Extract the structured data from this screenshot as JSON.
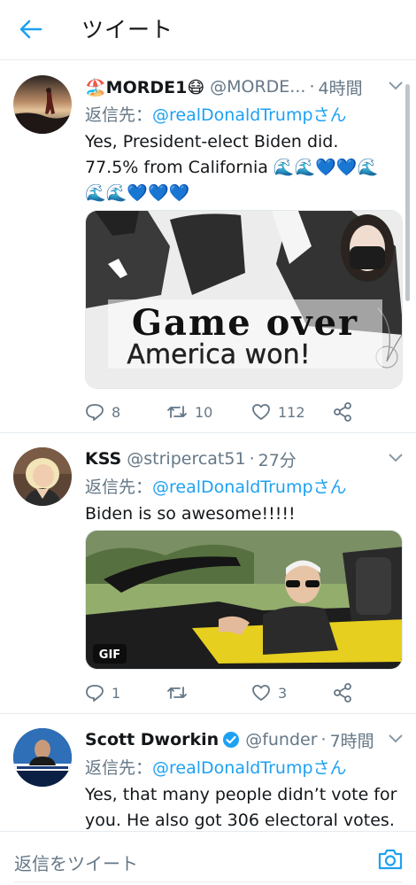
{
  "header": {
    "title": "ツイート"
  },
  "tweets": [
    {
      "name": "🏖️MORDE1😷",
      "handle": "@MORDE...",
      "time": "4時間",
      "reply_prefix": "返信先：",
      "reply_mention": "@realDonaldTrumpさん",
      "text_line1": "Yes, President-elect Biden did.",
      "text_line2": "77.5% from California 🌊🌊💙💙🌊",
      "text_line3": "🌊🌊💙💙💙",
      "media_caption_top": "Game over",
      "media_caption_bottom": "America won!",
      "replies": "8",
      "retweets": "10",
      "likes": "112"
    },
    {
      "name": "KSS",
      "handle": "@stripercat51",
      "time": "27分",
      "reply_prefix": "返信先：",
      "reply_mention": "@realDonaldTrumpさん",
      "text_line1": "Biden is so awesome!!!!!",
      "media_badge": "GIF",
      "replies": "1",
      "retweets": "",
      "likes": "3"
    },
    {
      "name": "Scott Dworkin",
      "handle": "@funder",
      "time": "7時間",
      "reply_prefix": "返信先：",
      "reply_mention": "@realDonaldTrumpさん",
      "text_line1": "Yes, that many people didn’t vote for",
      "text_line2": "you. He also got 306 electoral votes."
    }
  ],
  "reply_bar": {
    "placeholder": "返信をツイート"
  },
  "colors": {
    "accent": "#1da1f2",
    "secondary_text": "#657786",
    "divider": "#e6ecf0"
  },
  "icons": [
    "back-arrow-icon",
    "caret-down-icon",
    "reply-icon",
    "retweet-icon",
    "like-icon",
    "share-icon",
    "verified-badge-icon",
    "camera-icon"
  ]
}
